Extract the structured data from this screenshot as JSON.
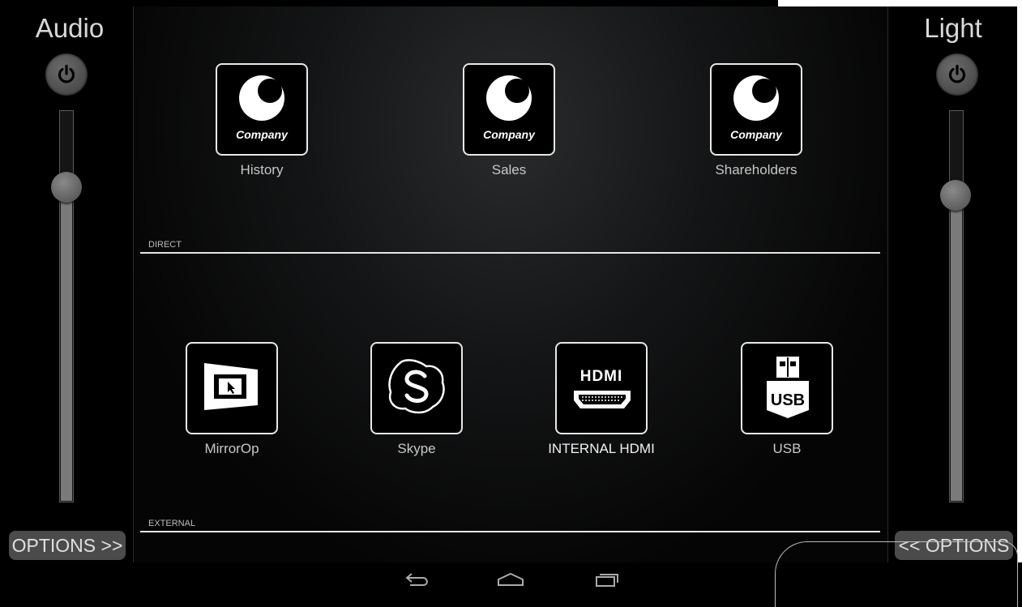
{
  "audio": {
    "title": "Audio",
    "level_percent": 81,
    "options_label": "OPTIONS >>"
  },
  "light": {
    "title": "Light",
    "level_percent": 79,
    "options_label": "<< OPTIONS"
  },
  "direct": {
    "section_label": "DIRECT",
    "tiles": [
      {
        "label": "History",
        "logo_text": "Company",
        "icon": "company-logo-icon"
      },
      {
        "label": "Sales",
        "logo_text": "Company",
        "icon": "company-logo-icon"
      },
      {
        "label": "Shareholders",
        "logo_text": "Company",
        "icon": "company-logo-icon"
      }
    ]
  },
  "external": {
    "section_label": "EXTERNAL",
    "tiles": [
      {
        "label": "MirrorOp",
        "icon": "mirrorop-icon"
      },
      {
        "label": "Skype",
        "icon": "skype-icon"
      },
      {
        "label": "INTERNAL HDMI",
        "icon": "hdmi-icon",
        "icon_text": "HDMI"
      },
      {
        "label": "USB",
        "icon": "usb-icon",
        "icon_text": "USB"
      }
    ]
  },
  "navbar": {
    "icons": [
      "back-icon",
      "home-icon",
      "recent-apps-icon"
    ]
  }
}
